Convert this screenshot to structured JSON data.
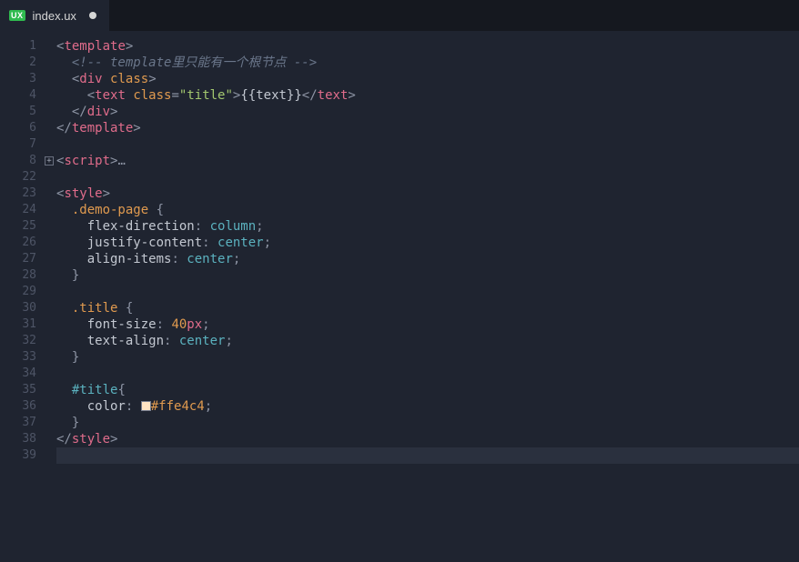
{
  "tab": {
    "icon_text": "UX",
    "filename": "index.ux",
    "dirty": true
  },
  "gutter": {
    "fold_glyph": "+"
  },
  "lines": [
    {
      "num": "1",
      "fold": "",
      "kind": "code",
      "tokens": [
        [
          "punc",
          "<"
        ],
        [
          "tag",
          "template"
        ],
        [
          "punc",
          ">"
        ]
      ]
    },
    {
      "num": "2",
      "fold": "",
      "kind": "comment",
      "indent": 1,
      "text": "<!-- template里只能有一个根节点 -->"
    },
    {
      "num": "3",
      "fold": "",
      "kind": "code",
      "indent": 1,
      "tokens": [
        [
          "punc",
          "<"
        ],
        [
          "tag",
          "div"
        ],
        [
          "plain",
          " "
        ],
        [
          "attr",
          "class"
        ],
        [
          "punc",
          ">"
        ]
      ]
    },
    {
      "num": "4",
      "fold": "",
      "kind": "code",
      "indent": 2,
      "tokens": [
        [
          "punc",
          "<"
        ],
        [
          "tag",
          "text"
        ],
        [
          "plain",
          " "
        ],
        [
          "attr",
          "class"
        ],
        [
          "punc",
          "="
        ],
        [
          "str",
          "\"title\""
        ],
        [
          "punc",
          ">"
        ],
        [
          "mustache",
          "{{text}}"
        ],
        [
          "punc",
          "</"
        ],
        [
          "tag",
          "text"
        ],
        [
          "punc",
          ">"
        ]
      ]
    },
    {
      "num": "5",
      "fold": "",
      "kind": "code",
      "indent": 1,
      "tokens": [
        [
          "punc",
          "</"
        ],
        [
          "tag",
          "div"
        ],
        [
          "punc",
          ">"
        ]
      ]
    },
    {
      "num": "6",
      "fold": "",
      "kind": "code",
      "tokens": [
        [
          "punc",
          "</"
        ],
        [
          "tag",
          "template"
        ],
        [
          "punc",
          ">"
        ]
      ]
    },
    {
      "num": "7",
      "fold": "",
      "kind": "blank"
    },
    {
      "num": "8",
      "fold": "+",
      "kind": "code",
      "tokens": [
        [
          "punc",
          "<"
        ],
        [
          "tag",
          "script"
        ],
        [
          "punc",
          ">"
        ],
        [
          "ellip",
          "…"
        ]
      ]
    },
    {
      "num": "22",
      "fold": "",
      "kind": "blank"
    },
    {
      "num": "23",
      "fold": "",
      "kind": "code",
      "tokens": [
        [
          "punc",
          "<"
        ],
        [
          "tag",
          "style"
        ],
        [
          "punc",
          ">"
        ]
      ]
    },
    {
      "num": "24",
      "fold": "",
      "kind": "code",
      "indent": 1,
      "tokens": [
        [
          "sel-cls",
          ".demo-page"
        ],
        [
          "plain",
          " "
        ],
        [
          "punc",
          "{"
        ]
      ]
    },
    {
      "num": "25",
      "fold": "",
      "kind": "code",
      "indent": 2,
      "tokens": [
        [
          "prop",
          "flex-direction"
        ],
        [
          "punc",
          ": "
        ],
        [
          "val",
          "column"
        ],
        [
          "punc",
          ";"
        ]
      ]
    },
    {
      "num": "26",
      "fold": "",
      "kind": "code",
      "indent": 2,
      "tokens": [
        [
          "prop",
          "justify-content"
        ],
        [
          "punc",
          ": "
        ],
        [
          "val",
          "center"
        ],
        [
          "punc",
          ";"
        ]
      ]
    },
    {
      "num": "27",
      "fold": "",
      "kind": "code",
      "indent": 2,
      "tokens": [
        [
          "prop",
          "align-items"
        ],
        [
          "punc",
          ": "
        ],
        [
          "val",
          "center"
        ],
        [
          "punc",
          ";"
        ]
      ]
    },
    {
      "num": "28",
      "fold": "",
      "kind": "code",
      "indent": 1,
      "tokens": [
        [
          "punc",
          "}"
        ]
      ]
    },
    {
      "num": "29",
      "fold": "",
      "kind": "blank"
    },
    {
      "num": "30",
      "fold": "",
      "kind": "code",
      "indent": 1,
      "tokens": [
        [
          "sel-cls",
          ".title"
        ],
        [
          "plain",
          " "
        ],
        [
          "punc",
          "{"
        ]
      ]
    },
    {
      "num": "31",
      "fold": "",
      "kind": "code",
      "indent": 2,
      "tokens": [
        [
          "prop",
          "font-size"
        ],
        [
          "punc",
          ": "
        ],
        [
          "num",
          "40"
        ],
        [
          "unit",
          "px"
        ],
        [
          "punc",
          ";"
        ]
      ]
    },
    {
      "num": "32",
      "fold": "",
      "kind": "code",
      "indent": 2,
      "tokens": [
        [
          "prop",
          "text-align"
        ],
        [
          "punc",
          ": "
        ],
        [
          "val",
          "center"
        ],
        [
          "punc",
          ";"
        ]
      ]
    },
    {
      "num": "33",
      "fold": "",
      "kind": "code",
      "indent": 1,
      "tokens": [
        [
          "punc",
          "}"
        ]
      ]
    },
    {
      "num": "34",
      "fold": "",
      "kind": "blank"
    },
    {
      "num": "35",
      "fold": "",
      "kind": "code",
      "indent": 1,
      "tokens": [
        [
          "sel-id",
          "#title"
        ],
        [
          "punc",
          "{"
        ]
      ]
    },
    {
      "num": "36",
      "fold": "",
      "kind": "code",
      "indent": 2,
      "tokens": [
        [
          "prop",
          "color"
        ],
        [
          "punc",
          ": "
        ],
        [
          "swatch",
          ""
        ],
        [
          "hex",
          "#ffe4c4"
        ],
        [
          "punc",
          ";"
        ]
      ]
    },
    {
      "num": "37",
      "fold": "",
      "kind": "code",
      "indent": 1,
      "tokens": [
        [
          "punc",
          "}"
        ]
      ]
    },
    {
      "num": "38",
      "fold": "",
      "kind": "code",
      "tokens": [
        [
          "punc",
          "</"
        ],
        [
          "tag",
          "style"
        ],
        [
          "punc",
          ">"
        ]
      ]
    },
    {
      "num": "39",
      "fold": "",
      "kind": "blank",
      "current": true
    }
  ],
  "colors": {
    "swatch_hex": "#ffe4c4"
  }
}
